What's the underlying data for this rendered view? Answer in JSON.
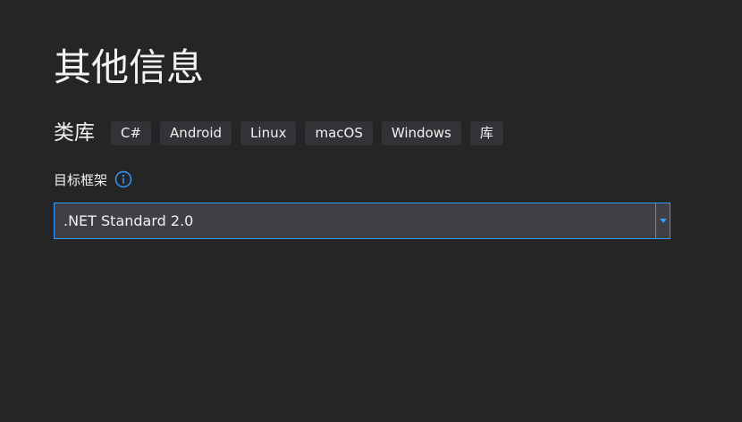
{
  "page": {
    "title": "其他信息"
  },
  "template": {
    "name": "类库",
    "tags": [
      "C#",
      "Android",
      "Linux",
      "macOS",
      "Windows",
      "库"
    ]
  },
  "framework": {
    "label": "目标框架",
    "info_icon": "info-icon",
    "selected_value": ".NET Standard 2.0",
    "dropdown_icon": "chevron-down-icon"
  },
  "colors": {
    "background": "#252526",
    "tag_background": "#333337",
    "select_background": "#3f3f46",
    "accent": "#3399ff"
  }
}
